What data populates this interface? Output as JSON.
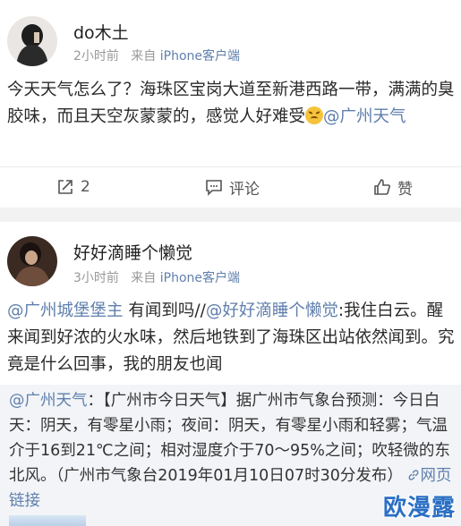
{
  "post1": {
    "username": "do木土",
    "time": "2小时前",
    "via_prefix": "来自",
    "source": "iPhone客户端",
    "text_main": "今天天气怎么了？海珠区宝岗大道至新港西路一带，满满的臭胶味，而且天空灰蒙蒙的，感觉人好难受",
    "emoji": "persevering-face-icon",
    "mention": "@广州天气",
    "repost_count": "2",
    "comment_label": "评论",
    "like_label": "赞"
  },
  "post2": {
    "username": "好好滴睡个懒觉",
    "time": "3小时前",
    "via_prefix": "来自",
    "source": "iPhone客户端",
    "mention1": "@广州城堡堡主",
    "text1": " 有闻到吗//",
    "mention2": "@好好滴睡个懒觉",
    "text2": ":我住白云。醒来闻到好浓的火水味，然后地铁到了海珠区出站依然闻到。究竟是什么回事，我的朋友也闻",
    "quote": {
      "mention": "@广州天气",
      "text": "：【广州市今日天气】据广州市气象台预测：今日白天：阴天，有零星小雨；夜间：阴天，有零星小雨和轻雾；气温介于16到21℃之间；相对湿度介于70～95%之间；吹轻微的东北风。（广州市气象台2019年01月10日07时30分发布）",
      "link_label": "网页链接"
    }
  },
  "watermark": "欧漫露",
  "colors": {
    "link": "#5f7fad",
    "meta": "#999999",
    "quote_bg": "#f2f4f7",
    "watermark": "#2a6fc4"
  }
}
